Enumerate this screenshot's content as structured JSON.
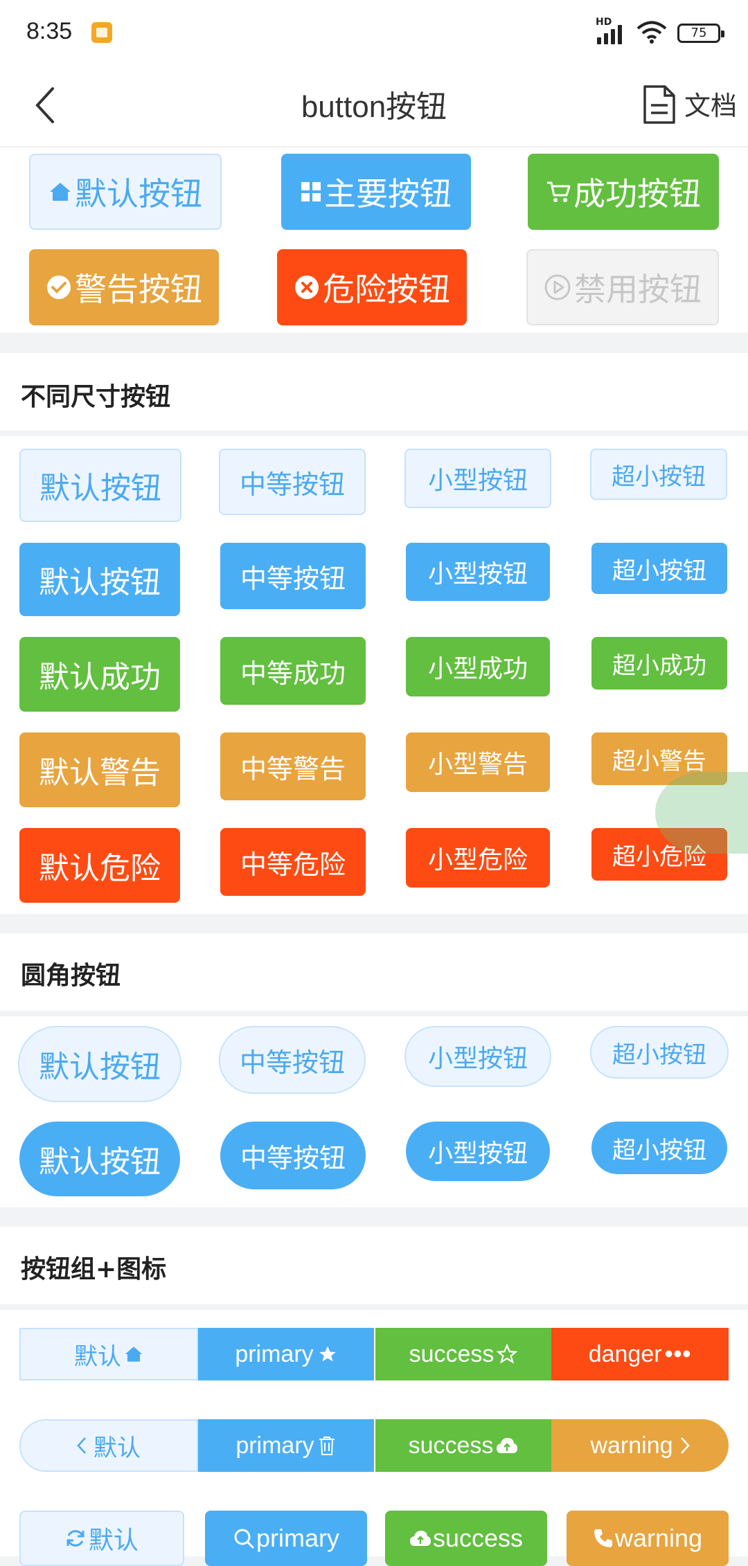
{
  "status_bar": {
    "time": "8:35",
    "network": "HD",
    "battery": "75"
  },
  "nav": {
    "title": "button按钮",
    "doc_label": "文档"
  },
  "colors": {
    "default_bg": "#ecf5ff",
    "default_text": "#4ba9f0",
    "primary": "#4aaef5",
    "success": "#62bf3f",
    "warning": "#e7a43f",
    "danger": "#fe4b13",
    "disabled": "#c7c7c7"
  },
  "icon_buttons": [
    {
      "label": "默认按钮",
      "icon": "home-icon"
    },
    {
      "label": "主要按钮",
      "icon": "grid-icon"
    },
    {
      "label": "成功按钮",
      "icon": "cart-icon"
    },
    {
      "label": "警告按钮",
      "icon": "check-circle-icon"
    },
    {
      "label": "危险按钮",
      "icon": "close-circle-icon"
    },
    {
      "label": "禁用按钮",
      "icon": "play-circle-icon"
    }
  ],
  "sizes_section": {
    "title": "不同尺寸按钮",
    "rows": [
      [
        "默认按钮",
        "中等按钮",
        "小型按钮",
        "超小按钮"
      ],
      [
        "默认按钮",
        "中等按钮",
        "小型按钮",
        "超小按钮"
      ],
      [
        "默认成功",
        "中等成功",
        "小型成功",
        "超小成功"
      ],
      [
        "默认警告",
        "中等警告",
        "小型警告",
        "超小警告"
      ],
      [
        "默认危险",
        "中等危险",
        "小型危险",
        "超小危险"
      ]
    ]
  },
  "round_section": {
    "title": "圆角按钮",
    "rows": [
      [
        "默认按钮",
        "中等按钮",
        "小型按钮",
        "超小按钮"
      ],
      [
        "默认按钮",
        "中等按钮",
        "小型按钮",
        "超小按钮"
      ]
    ]
  },
  "group_section": {
    "title": "按钮组+图标",
    "group1": [
      {
        "label": "默认",
        "icon": "home-icon"
      },
      {
        "label": "primary",
        "icon": "star-icon"
      },
      {
        "label": "success",
        "icon": "star-outline-icon"
      },
      {
        "label": "danger",
        "icon": "more-icon"
      }
    ],
    "group2": [
      {
        "label": "默认",
        "icon": "chevron-left-icon"
      },
      {
        "label": "primary",
        "icon": "trash-icon"
      },
      {
        "label": "success",
        "icon": "cloud-upload-icon"
      },
      {
        "label": "warning",
        "icon": "chevron-right-icon"
      }
    ],
    "row3": [
      {
        "label": "默认",
        "icon": "refresh-icon"
      },
      {
        "label": "primary",
        "icon": "search-icon"
      },
      {
        "label": "success",
        "icon": "cloud-upload-icon"
      },
      {
        "label": "warning",
        "icon": "phone-icon"
      }
    ]
  }
}
